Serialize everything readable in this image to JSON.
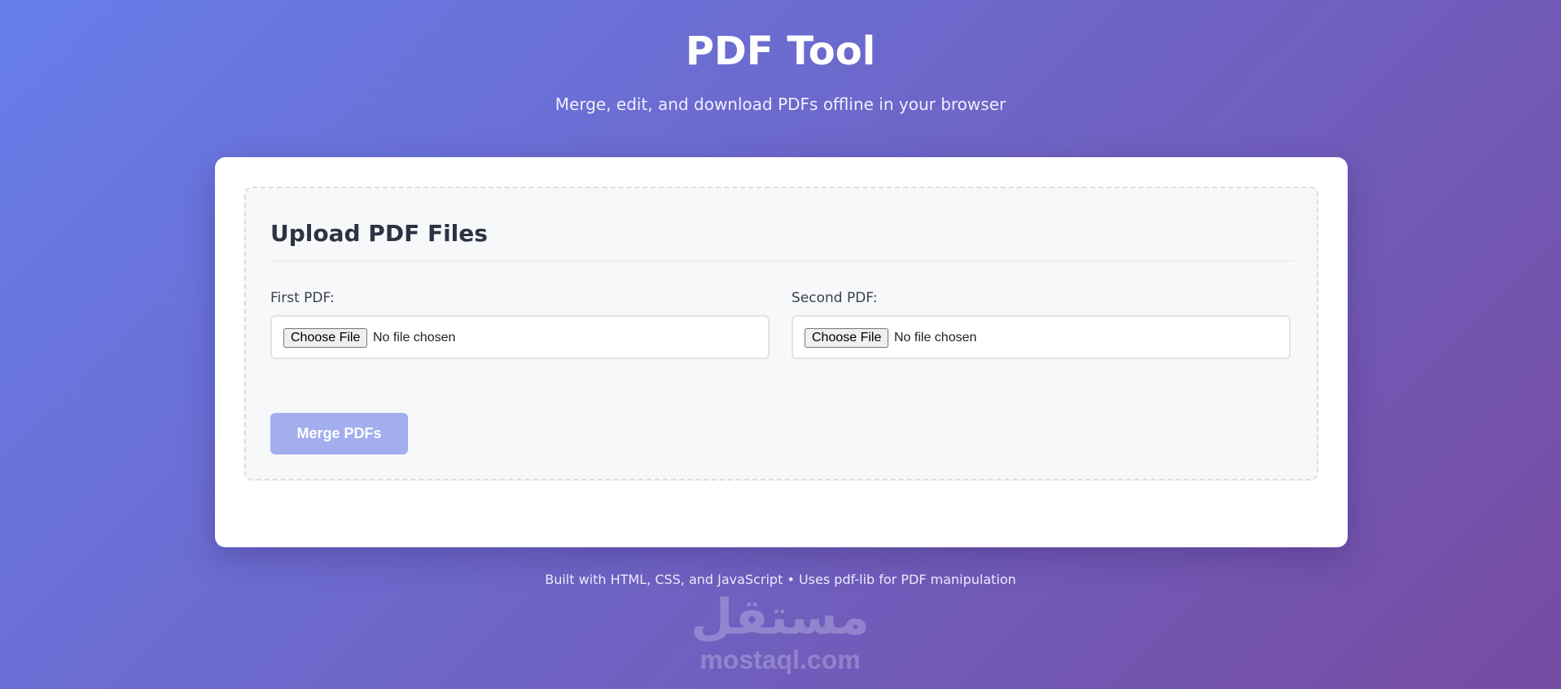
{
  "header": {
    "title": "PDF Tool",
    "subtitle": "Merge, edit, and download PDFs offline in your browser"
  },
  "upload": {
    "section_title": "Upload PDF Files",
    "first": {
      "label": "First PDF:",
      "button_label": "Choose File",
      "status": "No file chosen"
    },
    "second": {
      "label": "Second PDF:",
      "button_label": "Choose File",
      "status": "No file chosen"
    },
    "merge_label": "Merge PDFs",
    "merge_enabled": false
  },
  "footer": {
    "text": "Built with HTML, CSS, and JavaScript • Uses pdf-lib for PDF manipulation"
  },
  "watermark": {
    "arabic": "مستقل",
    "latin": "mostaql.com"
  },
  "colors": {
    "gradient_start": "#667eea",
    "gradient_end": "#764ba2",
    "merge_button_disabled": "#a2aeee"
  }
}
